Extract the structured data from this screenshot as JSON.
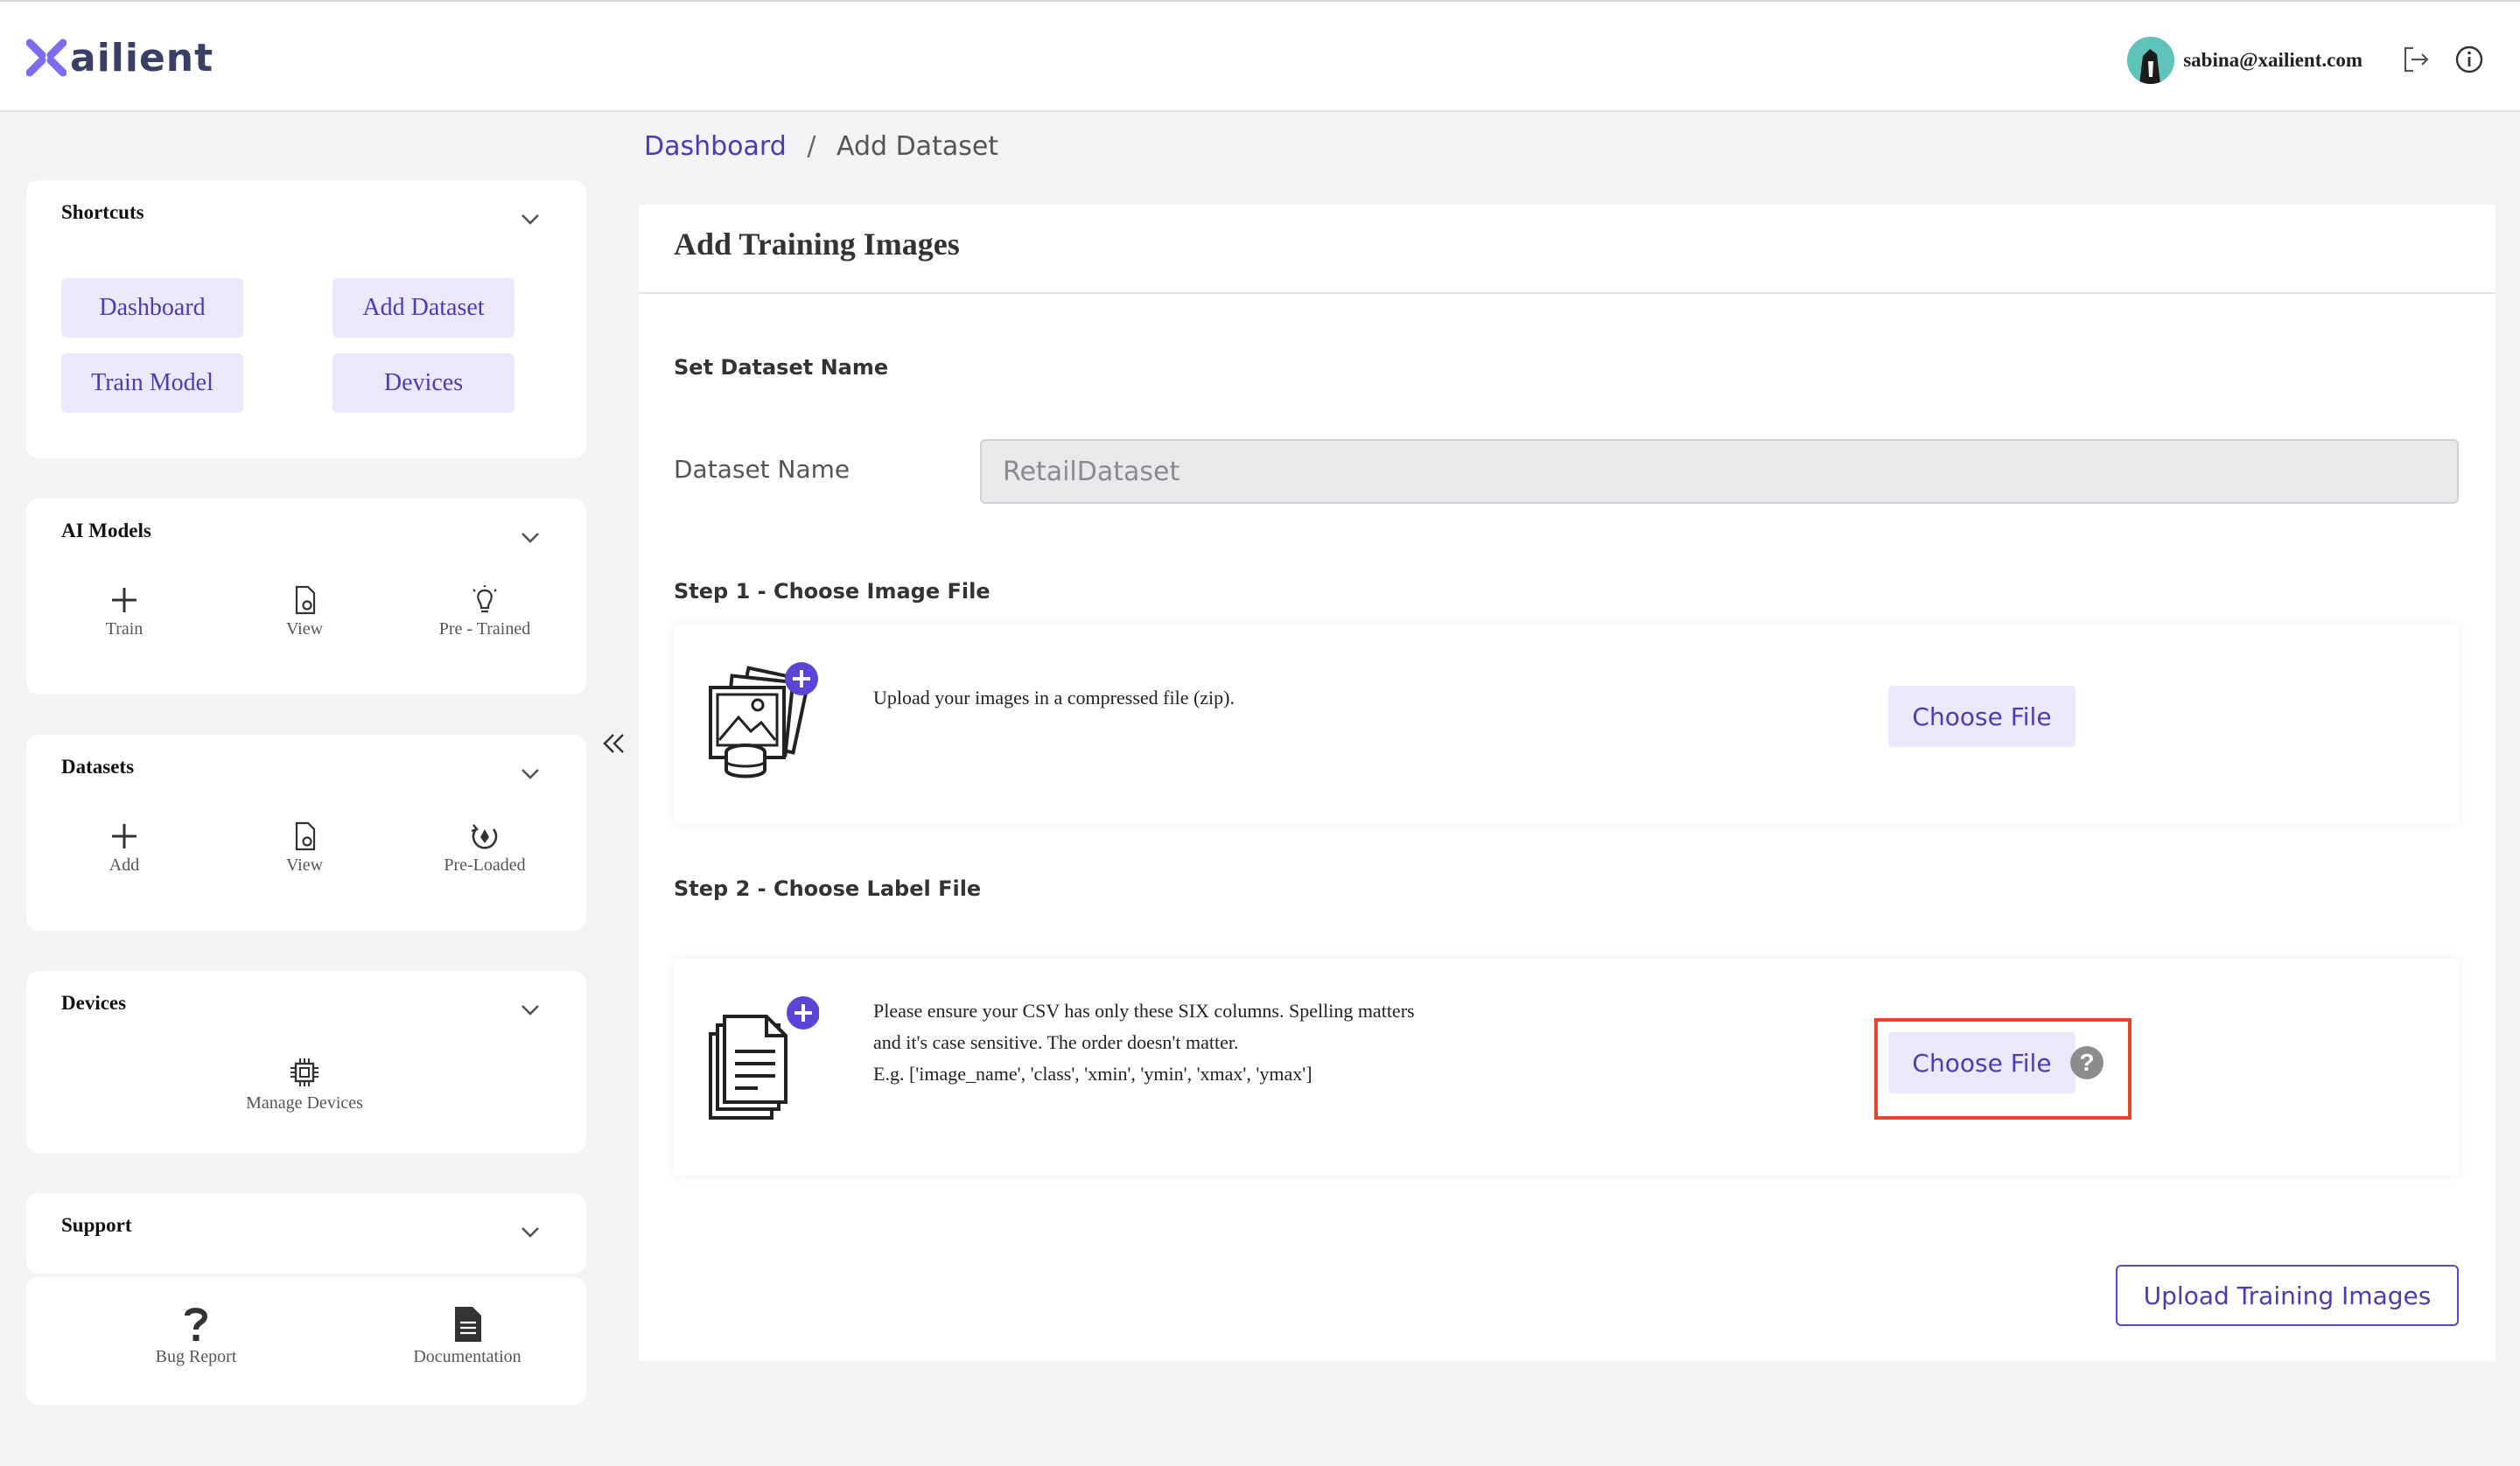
{
  "brand": {
    "logo_text": "ailient",
    "accent": "#4b3bb4"
  },
  "header": {
    "user_email": "sabina@xailient.com",
    "icons": [
      "logout-icon",
      "info-icon"
    ]
  },
  "sidebar": {
    "shortcuts": {
      "title": "Shortcuts",
      "buttons": [
        "Dashboard",
        "Add Dataset",
        "Train Model",
        "Devices"
      ]
    },
    "ai_models": {
      "title": "AI Models",
      "items": [
        "Train",
        "View",
        "Pre - Trained"
      ]
    },
    "datasets": {
      "title": "Datasets",
      "items": [
        "Add",
        "View",
        "Pre-Loaded"
      ]
    },
    "devices": {
      "title": "Devices",
      "items": [
        "Manage Devices"
      ]
    },
    "support": {
      "title": "Support",
      "items": [
        "Bug Report",
        "Documentation"
      ]
    }
  },
  "breadcrumb": {
    "parent": "Dashboard",
    "separator": "/",
    "current": "Add Dataset"
  },
  "main": {
    "title": "Add Training Images",
    "set_name_label": "Set Dataset Name",
    "dataset_name_label": "Dataset Name",
    "dataset_name_value": "RetailDataset",
    "step1": {
      "prefix": "Step 1",
      "label": " - Choose Image File",
      "description": "Upload your images in a compressed file (zip).",
      "button": "Choose File"
    },
    "step2": {
      "prefix": "Step 2",
      "label": " - Choose Label File",
      "desc_line1": "Please ensure your CSV has only these SIX columns. Spelling matters",
      "desc_line2": "and it's case sensitive. The order doesn't matter.",
      "desc_line3": "E.g. ['image_name', 'class', 'xmin', 'ymin', 'xmax', 'ymax']",
      "button": "Choose File",
      "help": "?"
    },
    "upload_button": "Upload Training Images"
  }
}
